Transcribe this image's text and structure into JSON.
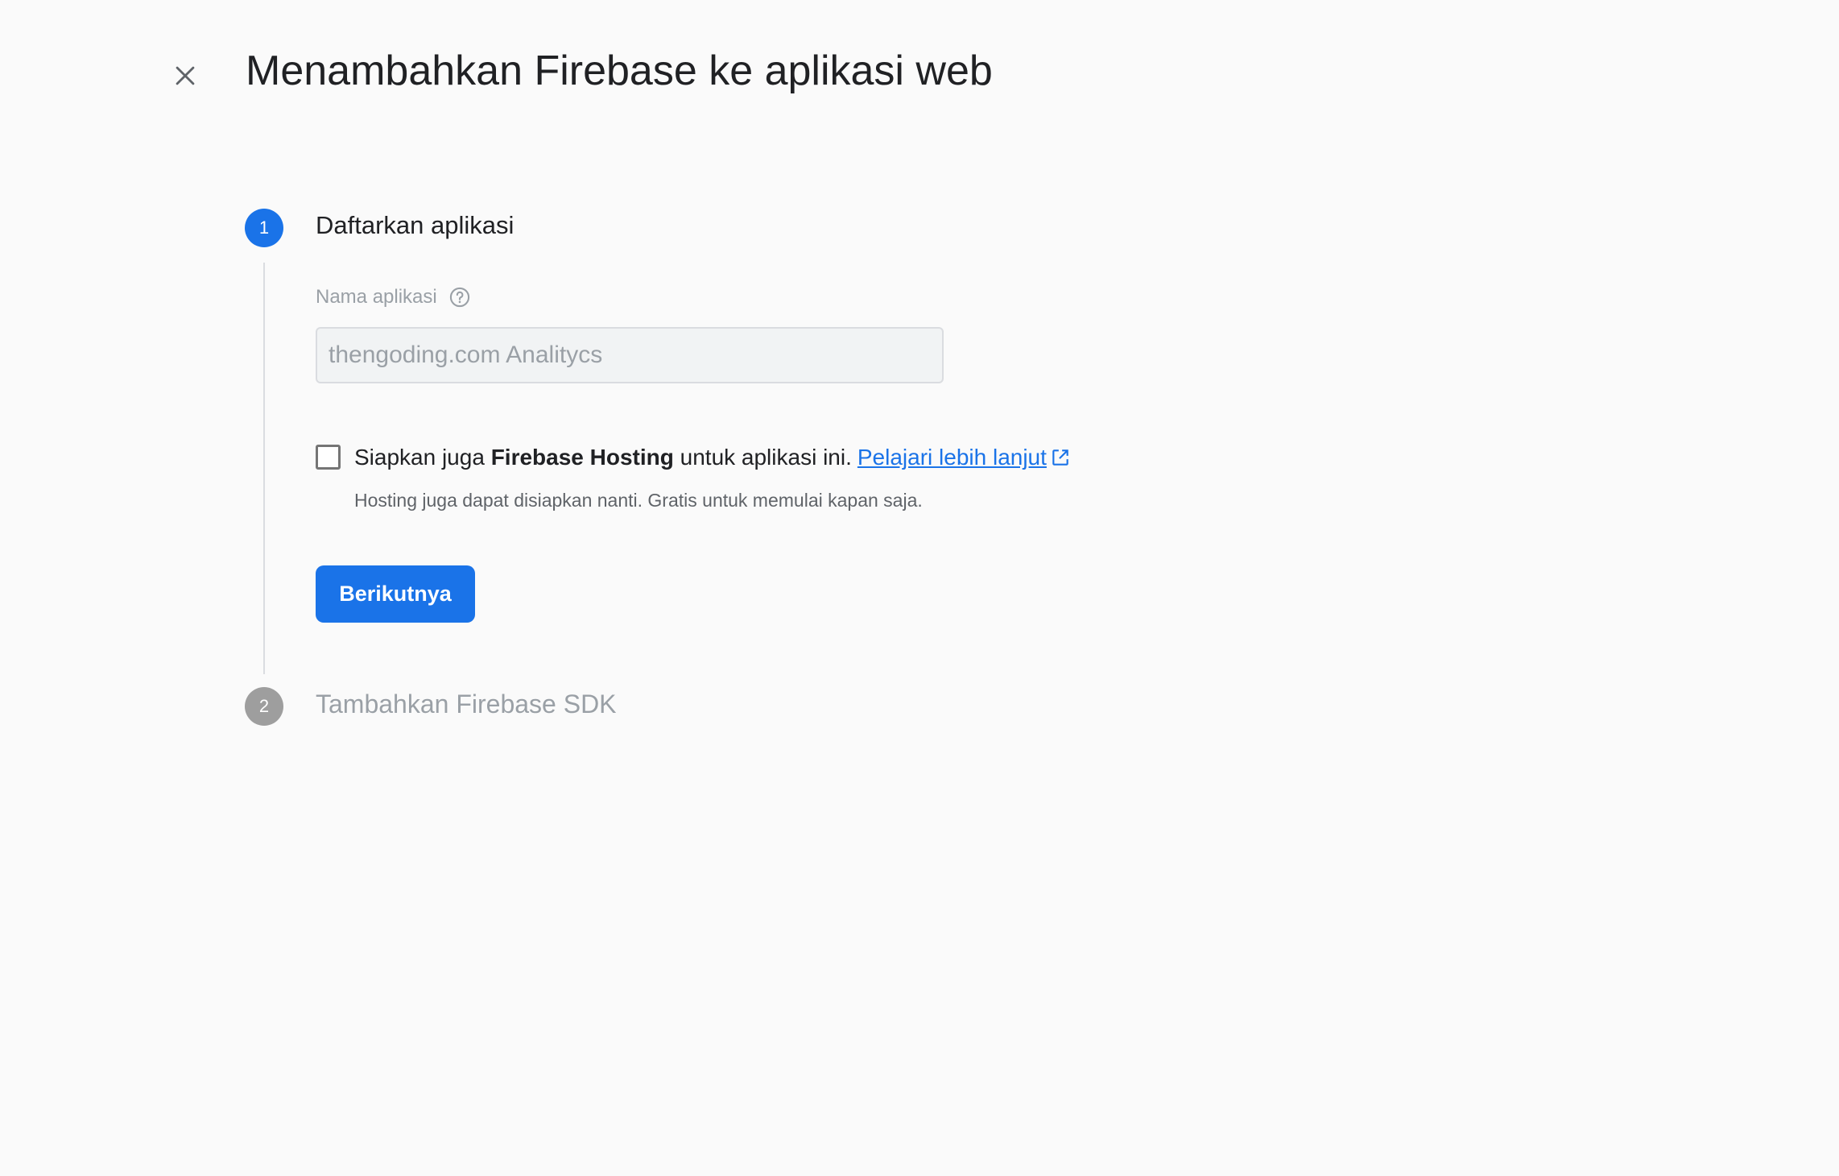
{
  "dialog": {
    "title": "Menambahkan Firebase ke aplikasi web",
    "close_icon": "close-icon"
  },
  "steps": [
    {
      "number": "1",
      "title": "Daftarkan aplikasi",
      "state": "active",
      "color": "#1a73e8"
    },
    {
      "number": "2",
      "title": "Tambahkan Firebase SDK",
      "state": "inactive",
      "color": "#9e9e9e"
    }
  ],
  "form": {
    "app_name_label": "Nama aplikasi",
    "help_icon": "help-circle-icon",
    "app_name_value": "thengoding.com Analitycs",
    "hosting_checked": false,
    "hosting_text_before": "Siapkan juga ",
    "hosting_text_bold": "Firebase Hosting",
    "hosting_text_after": " untuk aplikasi ini.",
    "learn_more_link": "Pelajari lebih lanjut",
    "external_link_icon": "external-link-icon",
    "hosting_note": "Hosting juga dapat disiapkan nanti. Gratis untuk memulai kapan saja.",
    "next_button": "Berikutnya"
  },
  "colors": {
    "accent": "#1a73e8",
    "background": "#fafafa"
  }
}
